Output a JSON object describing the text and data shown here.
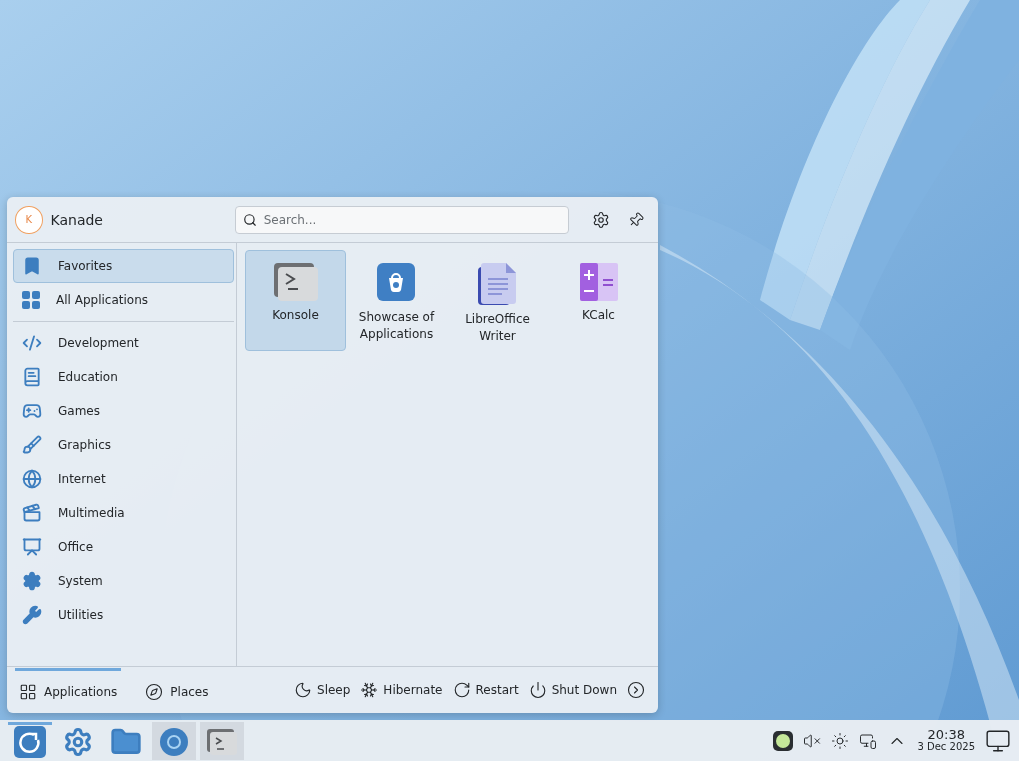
{
  "menu": {
    "user": {
      "initial": "K",
      "name": "Kanade"
    },
    "search": {
      "placeholder": "Search..."
    },
    "sidebar": [
      {
        "kind": "favorites",
        "label": "Favorites",
        "selected": true
      },
      {
        "kind": "all",
        "label": "All Applications",
        "selected": false
      },
      {
        "kind": "development",
        "label": "Development",
        "selected": false
      },
      {
        "kind": "education",
        "label": "Education",
        "selected": false
      },
      {
        "kind": "games",
        "label": "Games",
        "selected": false
      },
      {
        "kind": "graphics",
        "label": "Graphics",
        "selected": false
      },
      {
        "kind": "internet",
        "label": "Internet",
        "selected": false
      },
      {
        "kind": "multimedia",
        "label": "Multimedia",
        "selected": false
      },
      {
        "kind": "office",
        "label": "Office",
        "selected": false
      },
      {
        "kind": "system",
        "label": "System",
        "selected": false
      },
      {
        "kind": "utilities",
        "label": "Utilities",
        "selected": false
      }
    ],
    "apps": [
      {
        "kind": "terminal",
        "label": "Konsole",
        "selected": true
      },
      {
        "kind": "store",
        "label": "Showcase of Applications",
        "selected": false
      },
      {
        "kind": "writer",
        "label": "LibreOffice Writer",
        "selected": false
      },
      {
        "kind": "calculator",
        "label": "KCalc",
        "selected": false
      }
    ],
    "footer_tabs": [
      {
        "kind": "applications",
        "label": "Applications",
        "selected": true
      },
      {
        "kind": "places",
        "label": "Places",
        "selected": false
      }
    ],
    "power": [
      {
        "kind": "sleep",
        "label": "Sleep"
      },
      {
        "kind": "hibernate",
        "label": "Hibernate"
      },
      {
        "kind": "restart",
        "label": "Restart"
      },
      {
        "kind": "shutdown",
        "label": "Shut Down"
      }
    ]
  },
  "taskbar": {
    "items": [
      {
        "kind": "launcher",
        "selected": true,
        "running": false
      },
      {
        "kind": "settings",
        "selected": false,
        "running": false
      },
      {
        "kind": "files",
        "selected": false,
        "running": false
      },
      {
        "kind": "browser",
        "selected": false,
        "running": true
      },
      {
        "kind": "terminal",
        "selected": false,
        "running": true
      }
    ],
    "clock": {
      "time": "20:38",
      "date": "3 Dec 2025"
    }
  }
}
